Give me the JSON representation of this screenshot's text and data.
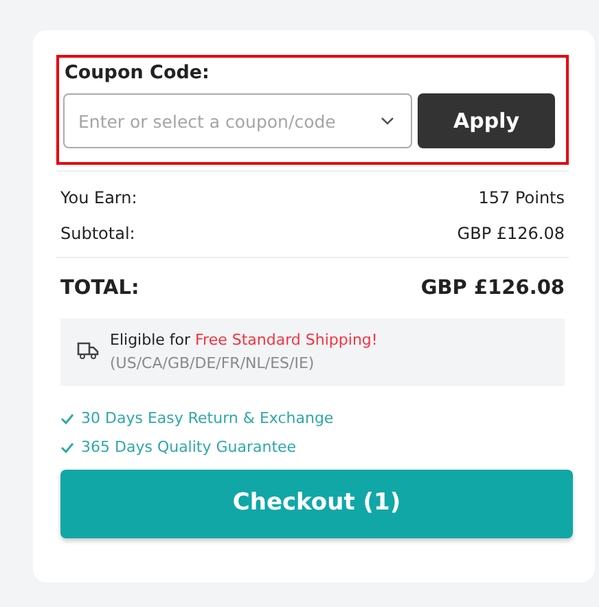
{
  "coupon": {
    "label": "Coupon Code:",
    "placeholder": "Enter or select a coupon/code",
    "button": "Apply",
    "highlighted": true
  },
  "summary": [
    {
      "label": "You Earn:",
      "value": "157 Points"
    },
    {
      "label": "Subtotal:",
      "value": "GBP £126.08"
    }
  ],
  "total": {
    "label": "TOTAL:",
    "value": "GBP £126.08"
  },
  "shipping": {
    "text": "Eligible for **Free Standard Shipping!**",
    "countries": "(US/CA/GB/DE/FR/NL/ES/IE)"
  },
  "guarantees": [
    "30 Days Easy Return & Exchange",
    "365 Days Quality Guarantee"
  ],
  "checkout": {
    "label": "Checkout (1)"
  }
}
